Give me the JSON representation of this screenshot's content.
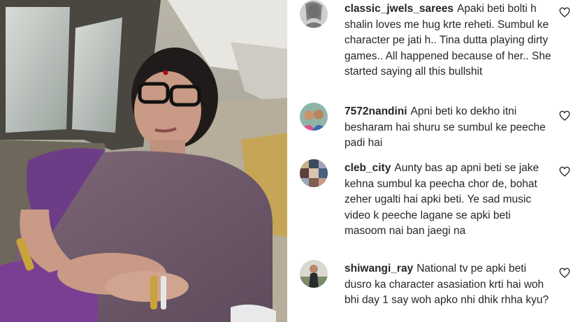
{
  "photo": {
    "alt_icon": "photo-of-woman-in-car"
  },
  "comments": [
    {
      "username": "classic_jwels_sarees",
      "text": "Apaki beti bolti h shalin loves me hug krte reheti. Sumbul ke character pe jati h.. Tina dutta playing dirty games.. All happened because of her.. She started saying all this bullshit",
      "avatar_icon": "avatar-image",
      "like_icon": "heart-outline-icon"
    },
    {
      "username": "7572nandini",
      "text": "Apni beti ko dekho itni besharam hai shuru se sumbul ke peeche padi hai",
      "avatar_icon": "avatar-image",
      "like_icon": "heart-outline-icon"
    },
    {
      "username": "cleb_city",
      "text": "Aunty bas ap apni beti se jake kehna sumbul ka peecha chor de, bohat zeher ugalti hai apki beti. Ye sad music video k peeche lagane se apki beti masoom nai ban jaegi na",
      "avatar_icon": "avatar-image",
      "like_icon": "heart-outline-icon"
    },
    {
      "username": "shiwangi_ray",
      "text": "National tv pe apki beti dusro ka character asasiation krti hai woh bhi day 1 say woh apko nhi dhik rhha kyu?",
      "avatar_icon": "avatar-image",
      "like_icon": "heart-outline-icon"
    }
  ],
  "colors": {
    "text": "#262626",
    "background": "#ffffff"
  }
}
